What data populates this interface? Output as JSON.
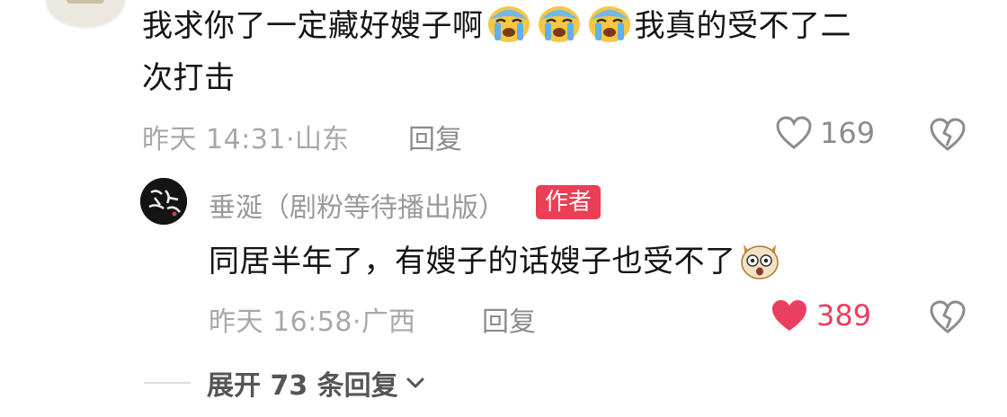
{
  "main_comment": {
    "text_part1": "我求你了一定藏好嫂子啊",
    "emojis": [
      "crying-emoji",
      "crying-emoji",
      "crying-emoji"
    ],
    "text_part2": "我真的受不了二",
    "text_line2": "次打击",
    "time": "昨天 14:31·",
    "location": "山东",
    "reply_label": "回复",
    "like_count": "169",
    "liked": false
  },
  "reply": {
    "author": "垂涎（剧粉等待播出版）",
    "badge": "作者",
    "avatar_text": "垂涎",
    "text": "同居半年了，有嫂子的话嫂子也受不了",
    "emoji": "shocked-dog-emoji",
    "time": "昨天 16:58·",
    "location": "广西",
    "reply_label": "回复",
    "like_count": "389",
    "liked": true
  },
  "expand": {
    "prefix": "展开 ",
    "count": "73",
    "suffix": " 条回复"
  },
  "colors": {
    "accent_red": "#ea3f55",
    "muted_text": "#a8a8a8",
    "body_text": "#141414"
  }
}
